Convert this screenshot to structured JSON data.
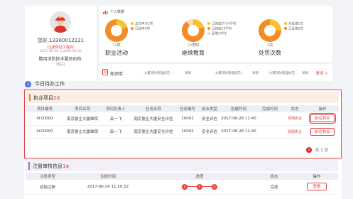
{
  "profile": {
    "name": "您好,13300012121",
    "warning": "（注册体验工程师）",
    "sub": "2017-06-28 ◎ 2020-06-24",
    "org": "鹏用消防技术服务机构:",
    "org_sub": "测试2"
  },
  "stats": {
    "header": "个人数据",
    "items": [
      {
        "count_value": "10",
        "count_unit": "项",
        "name": "职业活动",
        "legend": [
          "正在审计2项",
          "已经审8项"
        ],
        "colors": [
          "#fbc02d",
          "#f28c28"
        ],
        "shares": [
          0.2,
          0.8
        ]
      },
      {
        "count_value": "20",
        "count_unit": "学时",
        "name": "继续教育",
        "legend": [
          "已完成学习4学时",
          "已完成14学时",
          "还需2学时"
        ],
        "colors": [
          "#fbc02d",
          "#f28c28",
          "#f6d8b5"
        ],
        "shares": [
          0.2,
          0.7,
          0.1
        ]
      },
      {
        "count_value": "4",
        "count_unit": "次",
        "name": "处罚次数",
        "legend": [
          "未处理1次",
          "已处理3次"
        ],
        "colors": [
          "#fbc02d",
          "#f28c28"
        ],
        "shares": [
          0.25,
          0.75
        ]
      }
    ]
  },
  "kb": {
    "title": "知识库",
    "items": [
      "· 大厦消防管理规范...",
      "详情",
      "· 大厦消防管理规范...",
      "详情",
      "· 大厦消防管理规范...",
      "详情"
    ],
    "more": "更多 >"
  },
  "todo": {
    "title": "今日待办工作"
  },
  "projects": {
    "title": "执业项目",
    "count": "2",
    "unit": "项",
    "columns": [
      "项目编号",
      "项目名称",
      "项目负责人",
      "任务名称",
      "任务编号",
      "执业类型",
      "创建时间",
      "完成时间",
      "状态",
      "操作"
    ],
    "rows": [
      {
        "code": "ht10000",
        "name": "南京婴企大厦维保",
        "owner": "高一飞",
        "task": "南京婴企大厦安全评估",
        "task_no": "10002",
        "type": "安全评估",
        "created": "2017-06-28 11:40",
        "finished": "",
        "status": "现场执业",
        "action": "前往执业"
      },
      {
        "code": "ht10000",
        "name": "南京婴企大厦维保",
        "owner": "高一飞",
        "task": "南京婴企大厦安全评估",
        "task_no": "10002",
        "type": "安全评估",
        "created": "2017-06-28 11:40",
        "finished": "",
        "status": "现场执业",
        "action": "前往执业"
      }
    ],
    "pager": {
      "current": "1",
      "total_text": "共 1 页"
    }
  },
  "registration": {
    "title": "注册审核信息",
    "count": "1",
    "unit": "条",
    "columns": [
      "注册类型",
      "注册时间",
      "进度",
      "状态",
      "操作"
    ],
    "rows": [
      {
        "type": "初始注册",
        "time": "2017-06-24 11:20:22",
        "steps": [
          "1",
          "2",
          "3"
        ],
        "status": "完成",
        "action": "查看"
      }
    ]
  },
  "colors": {
    "accent": "#e84141",
    "orange": "#e8832a",
    "purple": "#b46ad4"
  }
}
